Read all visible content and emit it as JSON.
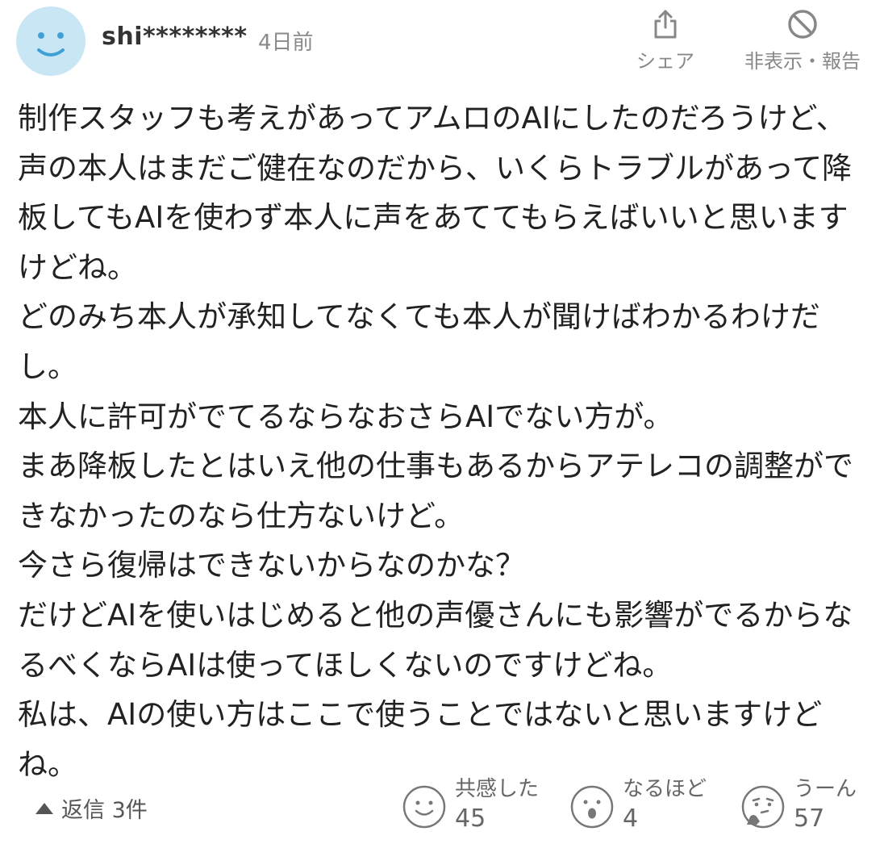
{
  "comment": {
    "username": "shi********",
    "timestamp": "4日前",
    "share_label": "シェア",
    "report_label": "非表示・報告",
    "body": "制作スタッフも考えがあってアムロのAIにしたのだろうけど、声の本人はまだご健在なのだから、いくらトラブルがあって降板してもAIを使わず本人に声をあててもらえばいいと思いますけどね。\nどのみち本人が承知してなくても本人が聞けばわかるわけだし。\n本人に許可がでてるならなおさらAIでない方が。\nまあ降板したとはいえ他の仕事もあるからアテレコの調整ができなかったのなら仕方ないけど。\n今さら復帰はできないからなのかな？\nだけどAIを使いはじめると他の声優さんにも影響がでるからなるべくならAIは使ってほしくないのですけどね。\n私は、AIの使い方はここで使うことではないと思いますけどね。"
  },
  "replies": {
    "label": "返信 3件"
  },
  "reactions": [
    {
      "label": "共感した",
      "count": "45",
      "icon": "smile-face-icon"
    },
    {
      "label": "なるほど",
      "count": "4",
      "icon": "surprised-face-icon"
    },
    {
      "label": "うーん",
      "count": "57",
      "icon": "thinking-face-icon"
    }
  ],
  "colors": {
    "avatar_bg": "#c9e6f4",
    "avatar_face": "#3fa0d6",
    "muted_text": "#888888",
    "body_text": "#222222"
  }
}
